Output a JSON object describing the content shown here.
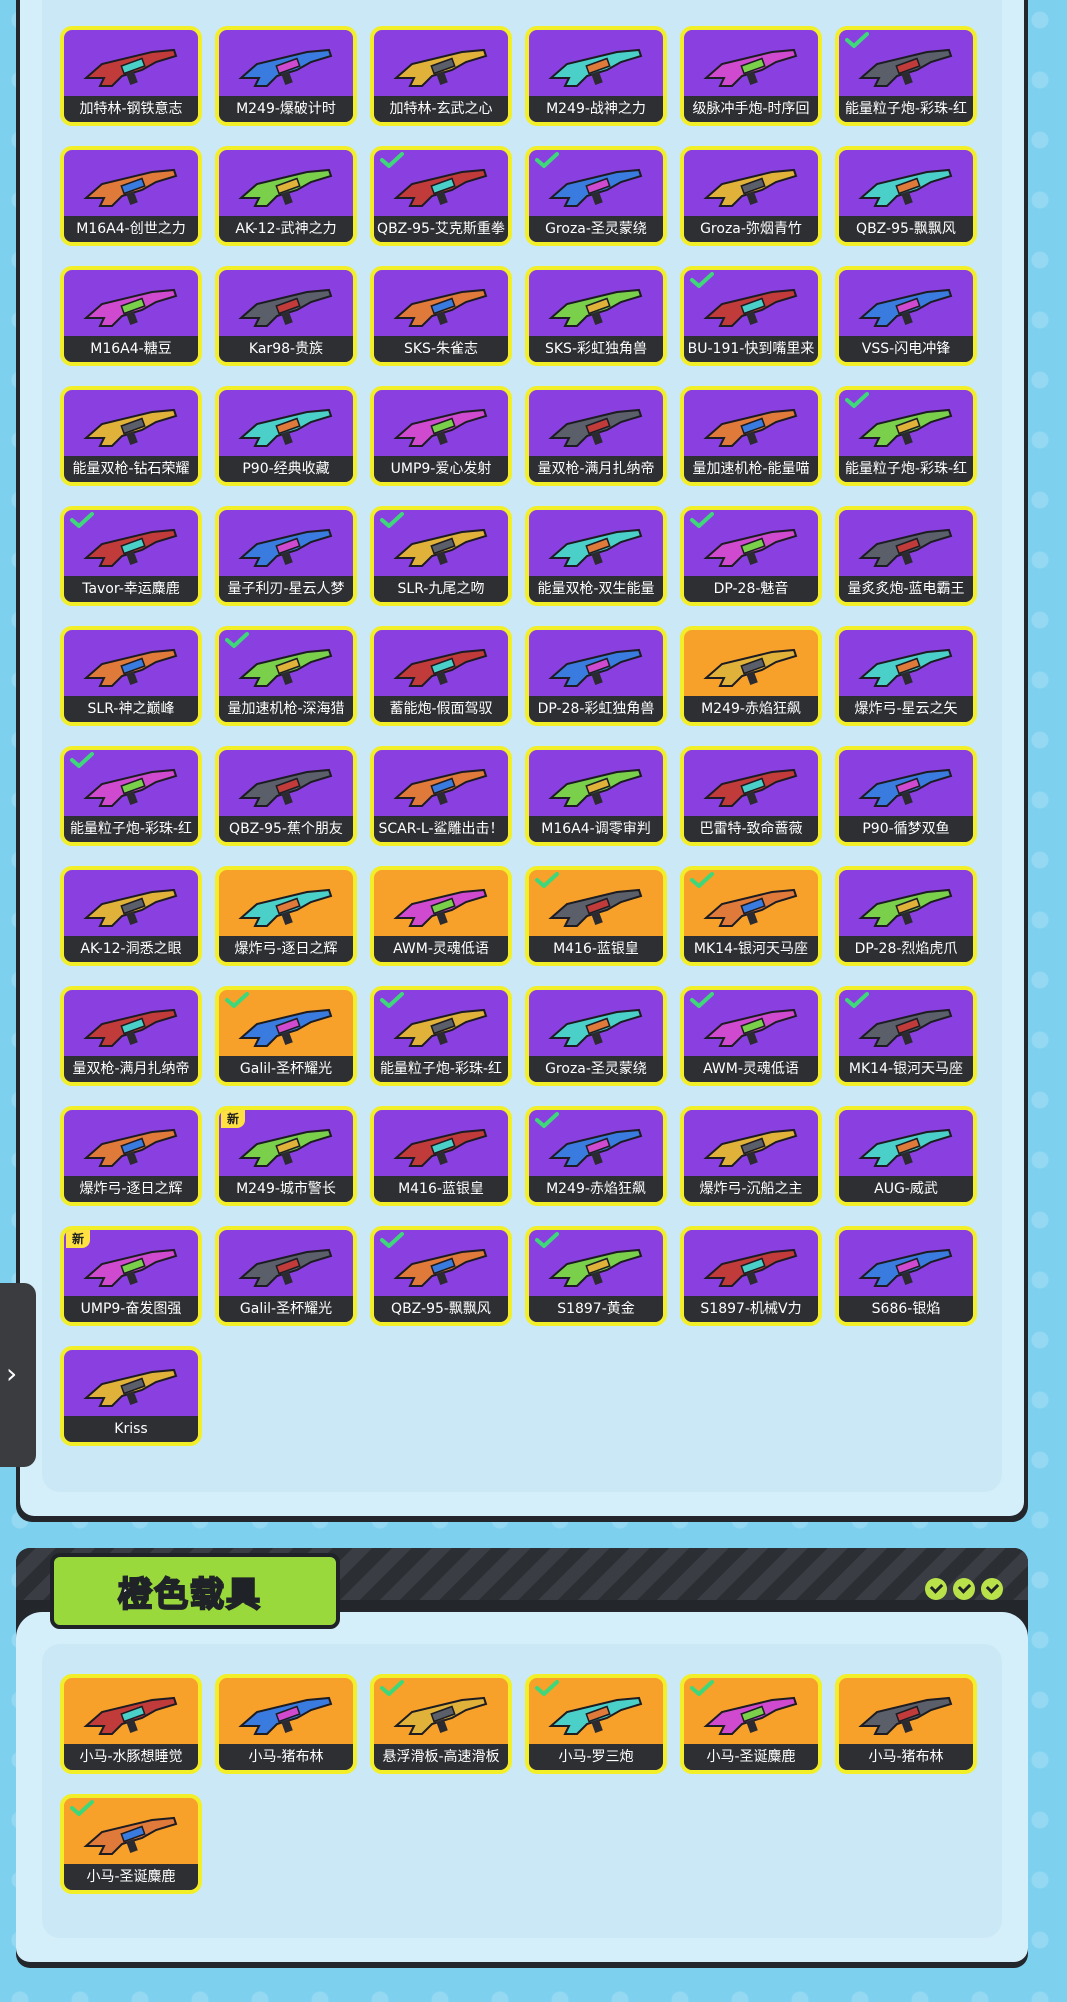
{
  "weapons": [
    {
      "label": "加特林-钢铁意志",
      "bg": "purple",
      "check": false,
      "new": false
    },
    {
      "label": "M249-爆破计时",
      "bg": "purple",
      "check": false,
      "new": false
    },
    {
      "label": "加特林-玄武之心",
      "bg": "purple",
      "check": false,
      "new": false
    },
    {
      "label": "M249-战神之力",
      "bg": "purple",
      "check": false,
      "new": false
    },
    {
      "label": "级脉冲手炮-时序回",
      "bg": "purple",
      "check": false,
      "new": false
    },
    {
      "label": "能量粒子炮-彩珠-红",
      "bg": "purple",
      "check": true,
      "new": false
    },
    {
      "label": "M16A4-创世之力",
      "bg": "purple",
      "check": false,
      "new": false
    },
    {
      "label": "AK-12-武神之力",
      "bg": "purple",
      "check": false,
      "new": false
    },
    {
      "label": "QBZ-95-艾克斯重拳",
      "bg": "purple",
      "check": true,
      "new": false
    },
    {
      "label": "Groza-圣灵蒙绕",
      "bg": "purple",
      "check": true,
      "new": false
    },
    {
      "label": "Groza-弥烟青竹",
      "bg": "purple",
      "check": false,
      "new": false
    },
    {
      "label": "QBZ-95-飘飘风",
      "bg": "purple",
      "check": false,
      "new": false
    },
    {
      "label": "M16A4-糖豆",
      "bg": "purple",
      "check": false,
      "new": false
    },
    {
      "label": "Kar98-贵族",
      "bg": "purple",
      "check": false,
      "new": false
    },
    {
      "label": "SKS-朱雀志",
      "bg": "purple",
      "check": false,
      "new": false
    },
    {
      "label": "SKS-彩虹独角兽",
      "bg": "purple",
      "check": false,
      "new": false
    },
    {
      "label": "BU-191-快到嘴里来",
      "bg": "purple",
      "check": true,
      "new": false
    },
    {
      "label": "VSS-闪电冲锋",
      "bg": "purple",
      "check": false,
      "new": false
    },
    {
      "label": "能量双枪-钻石荣耀",
      "bg": "purple",
      "check": false,
      "new": false
    },
    {
      "label": "P90-经典收藏",
      "bg": "purple",
      "check": false,
      "new": false
    },
    {
      "label": "UMP9-爱心发射",
      "bg": "purple",
      "check": false,
      "new": false
    },
    {
      "label": "量双枪-满月扎纳帝",
      "bg": "purple",
      "check": false,
      "new": false
    },
    {
      "label": "量加速机枪-能量喵",
      "bg": "purple",
      "check": false,
      "new": false
    },
    {
      "label": "能量粒子炮-彩珠-红",
      "bg": "purple",
      "check": true,
      "new": false
    },
    {
      "label": "Tavor-幸运麋鹿",
      "bg": "purple",
      "check": true,
      "new": false
    },
    {
      "label": "量子利刃-星云人梦",
      "bg": "purple",
      "check": false,
      "new": false
    },
    {
      "label": "SLR-九尾之吻",
      "bg": "purple",
      "check": true,
      "new": false
    },
    {
      "label": "能量双枪-双生能量",
      "bg": "purple",
      "check": false,
      "new": false
    },
    {
      "label": "DP-28-魅音",
      "bg": "purple",
      "check": true,
      "new": false
    },
    {
      "label": "量炙炙炮-蓝电霸王",
      "bg": "purple",
      "check": false,
      "new": false
    },
    {
      "label": "SLR-神之巅峰",
      "bg": "purple",
      "check": false,
      "new": false
    },
    {
      "label": "量加速机枪-深海猎",
      "bg": "purple",
      "check": true,
      "new": false
    },
    {
      "label": "蓄能炮-假面驾驭",
      "bg": "purple",
      "check": false,
      "new": false
    },
    {
      "label": "DP-28-彩虹独角兽",
      "bg": "purple",
      "check": false,
      "new": false
    },
    {
      "label": "M249-赤焰狂飙",
      "bg": "orange",
      "check": false,
      "new": false
    },
    {
      "label": "爆炸弓-星云之矢",
      "bg": "purple",
      "check": false,
      "new": false
    },
    {
      "label": "能量粒子炮-彩珠-红",
      "bg": "purple",
      "check": true,
      "new": false
    },
    {
      "label": "QBZ-95-蕉个朋友",
      "bg": "purple",
      "check": false,
      "new": false
    },
    {
      "label": "SCAR-L-鲨雕出击！",
      "bg": "purple",
      "check": false,
      "new": false
    },
    {
      "label": "M16A4-调零审判",
      "bg": "purple",
      "check": false,
      "new": false
    },
    {
      "label": "巴雷特-致命蔷薇",
      "bg": "purple",
      "check": false,
      "new": false
    },
    {
      "label": "P90-循梦双鱼",
      "bg": "purple",
      "check": false,
      "new": false
    },
    {
      "label": "AK-12-洞悉之眼",
      "bg": "purple",
      "check": false,
      "new": false
    },
    {
      "label": "爆炸弓-逐日之辉",
      "bg": "orange",
      "check": false,
      "new": false
    },
    {
      "label": "AWM-灵魂低语",
      "bg": "orange",
      "check": false,
      "new": false
    },
    {
      "label": "M416-蓝银皇",
      "bg": "orange",
      "check": true,
      "new": false
    },
    {
      "label": "MK14-银河天马座",
      "bg": "orange",
      "check": true,
      "new": false
    },
    {
      "label": "DP-28-烈焰虎爪",
      "bg": "purple",
      "check": false,
      "new": false
    },
    {
      "label": "量双枪-满月扎纳帝",
      "bg": "purple",
      "check": false,
      "new": false
    },
    {
      "label": "Galil-圣杯耀光",
      "bg": "orange",
      "check": true,
      "new": false
    },
    {
      "label": "能量粒子炮-彩珠-红",
      "bg": "purple",
      "check": true,
      "new": false
    },
    {
      "label": "Groza-圣灵蒙绕",
      "bg": "purple",
      "check": false,
      "new": false
    },
    {
      "label": "AWM-灵魂低语",
      "bg": "purple",
      "check": true,
      "new": false
    },
    {
      "label": "MK14-银河天马座",
      "bg": "purple",
      "check": true,
      "new": false
    },
    {
      "label": "爆炸弓-逐日之辉",
      "bg": "purple",
      "check": false,
      "new": false
    },
    {
      "label": "M249-城市警长",
      "bg": "purple",
      "check": false,
      "new": true
    },
    {
      "label": "M416-蓝银皇",
      "bg": "purple",
      "check": false,
      "new": false
    },
    {
      "label": "M249-赤焰狂飙",
      "bg": "purple",
      "check": true,
      "new": false
    },
    {
      "label": "爆炸弓-沉船之主",
      "bg": "purple",
      "check": false,
      "new": false
    },
    {
      "label": "AUG-威武",
      "bg": "purple",
      "check": false,
      "new": false
    },
    {
      "label": "UMP9-奋发图强",
      "bg": "purple",
      "check": false,
      "new": true
    },
    {
      "label": "Galil-圣杯耀光",
      "bg": "purple",
      "check": false,
      "new": false
    },
    {
      "label": "QBZ-95-飘飘风",
      "bg": "purple",
      "check": true,
      "new": false
    },
    {
      "label": "S1897-黄金",
      "bg": "purple",
      "check": true,
      "new": false
    },
    {
      "label": "S1897-机械V力",
      "bg": "purple",
      "check": false,
      "new": false
    },
    {
      "label": "S686-银焰",
      "bg": "purple",
      "check": false,
      "new": false
    },
    {
      "label": "Kriss",
      "bg": "purple",
      "check": false,
      "new": false
    }
  ],
  "vehicle_section": {
    "title": "橙色载具",
    "items": [
      {
        "label": "小马-水豚想睡觉",
        "bg": "orange",
        "check": false
      },
      {
        "label": "小马-猪布林",
        "bg": "orange",
        "check": false
      },
      {
        "label": "悬浮滑板-高速滑板",
        "bg": "orange",
        "check": true
      },
      {
        "label": "小马-罗三炮",
        "bg": "orange",
        "check": true
      },
      {
        "label": "小马-圣诞麋鹿",
        "bg": "orange",
        "check": true
      },
      {
        "label": "小马-猪布林",
        "bg": "orange",
        "check": false
      },
      {
        "label": "小马-圣诞麋鹿",
        "bg": "orange",
        "check": true
      }
    ]
  },
  "new_badge_text": "新",
  "side_handle_icon": "chevron-right-icon",
  "colors": {
    "purple": "#8a3fe0",
    "orange": "#f7a12a",
    "border": "#f2ee28",
    "label_bg": "#2e2f33",
    "check": "#3ed77a"
  }
}
